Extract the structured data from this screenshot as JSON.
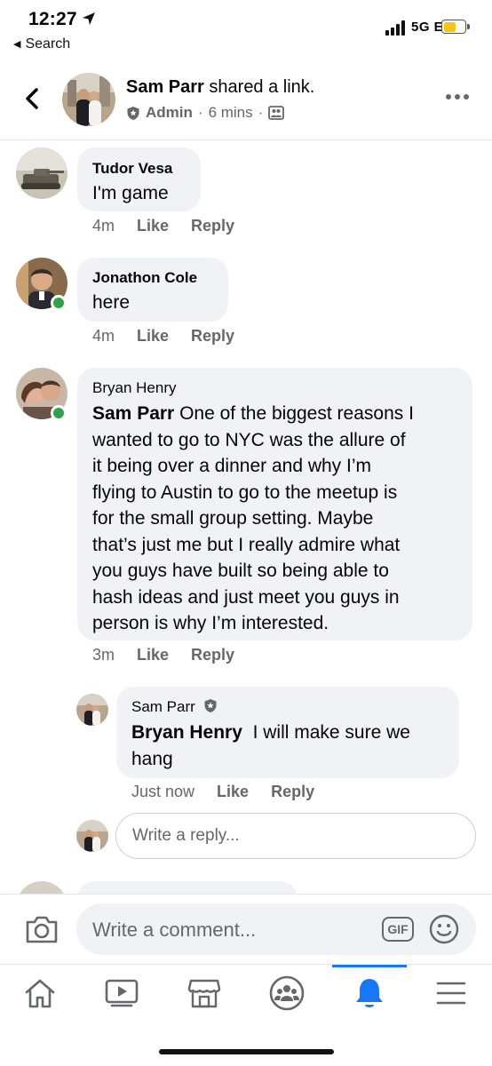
{
  "status_bar": {
    "time": "12:27",
    "back_app": "Search",
    "network": "5G E"
  },
  "header": {
    "author": "Sam Parr",
    "action": "shared a link.",
    "role": "Admin",
    "time": "6 mins",
    "separator": "·"
  },
  "comments": [
    {
      "author": "Tudor Vesa",
      "text": "I'm game",
      "time": "4m",
      "like": "Like",
      "reply": "Reply",
      "online": false
    },
    {
      "author": "Jonathon Cole",
      "text": "here",
      "time": "4m",
      "like": "Like",
      "reply": "Reply",
      "online": true
    },
    {
      "author": "Bryan Henry",
      "mention": "Sam Parr",
      "lines": [
        "One of the biggest reasons I",
        "wanted to go to NYC was the allure of",
        "it being over a dinner and why I’m",
        "flying to Austin to go to the meetup is",
        "for the small group setting. Maybe",
        "that’s just me but I really admire what",
        "you guys have built so being able to",
        "hash ideas and just meet you guys in",
        "person is why I’m interested."
      ],
      "time": "3m",
      "like": "Like",
      "reply": "Reply",
      "online": true
    }
  ],
  "reply": {
    "author": "Sam Parr",
    "mention": "Bryan Henry",
    "line1": "I will make sure we",
    "line2": "hang",
    "time": "Just now",
    "like": "Like",
    "reply": "Reply"
  },
  "reply_input": {
    "placeholder": "Write a reply..."
  },
  "composer": {
    "placeholder": "Write a comment...",
    "gif": "GIF"
  },
  "tabs": [
    "home-icon",
    "watch-icon",
    "marketplace-icon",
    "groups-icon",
    "notifications-icon",
    "menu-icon"
  ],
  "colors": {
    "accent": "#1877f2",
    "online": "#31a24c",
    "bubble": "#f0f2f5",
    "meta": "#65676b"
  }
}
